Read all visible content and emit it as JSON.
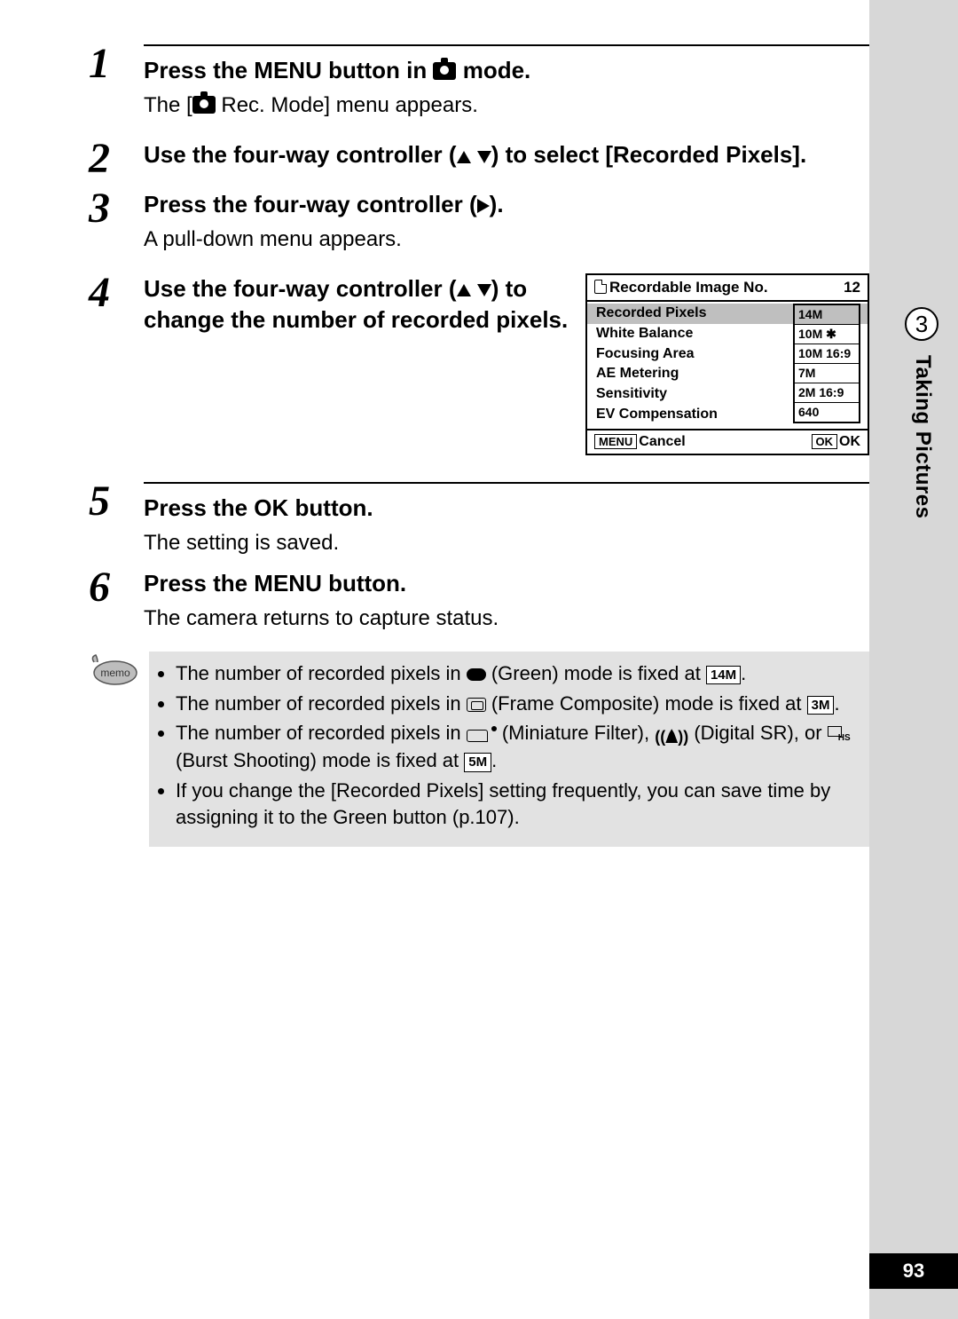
{
  "side": {
    "chapter_number": "3",
    "chapter_title": "Taking Pictures",
    "page_number": "93"
  },
  "steps": [
    {
      "num": "1",
      "title_before": "Press the ",
      "title_btn": "MENU",
      "title_mid": " button in ",
      "title_after": " mode.",
      "desc_before": "The [",
      "desc_after": " Rec. Mode] menu appears."
    },
    {
      "num": "2",
      "title": "Use the four-way controller (▲▼) to select [Recorded Pixels]."
    },
    {
      "num": "3",
      "title": "Press the four-way controller (▶).",
      "desc": "A pull-down menu appears."
    },
    {
      "num": "4",
      "title": "Use the four-way controller (▲▼) to change the number of recorded pixels."
    },
    {
      "num": "5",
      "title_before": "Press the ",
      "title_btn": "OK",
      "title_after": " button.",
      "desc": "The setting is saved."
    },
    {
      "num": "6",
      "title_before": "Press the ",
      "title_btn": "MENU",
      "title_after": " button.",
      "desc": "The camera returns to capture status."
    }
  ],
  "screen": {
    "header_label": "Recordable Image No.",
    "header_value": "12",
    "rows": [
      {
        "label": "Recorded Pixels",
        "selected": true
      },
      {
        "label": "White Balance"
      },
      {
        "label": "Focusing Area"
      },
      {
        "label": "AE Metering"
      },
      {
        "label": "Sensitivity"
      },
      {
        "label": "EV Compensation"
      }
    ],
    "dropdown": [
      "14M",
      "10M ✱",
      "10M 16:9",
      "7M",
      "2M 16:9",
      "640"
    ],
    "footer_left_btn": "MENU",
    "footer_left_txt": "Cancel",
    "footer_right_btn": "OK",
    "footer_right_txt": "OK"
  },
  "memo": {
    "icon_label": "memo",
    "items": {
      "a_pre": "The number of recorded pixels in ",
      "a_mid": " (Green) mode is fixed at ",
      "a_badge": "14M",
      "a_post": ".",
      "b_pre": "The number of recorded pixels in ",
      "b_mid": " (Frame Composite) mode is fixed at ",
      "b_badge": "3M",
      "b_post": ".",
      "c_pre": "The number of recorded pixels in ",
      "c_m1": " (Miniature Filter), ",
      "c_m2": " (Digital SR), or ",
      "c_m3": " (Burst Shooting) mode is fixed at ",
      "c_badge": "5M",
      "c_post": ".",
      "d": "If you change the [Recorded Pixels] setting frequently, you can save time by assigning it to the Green button (p.107)."
    }
  }
}
